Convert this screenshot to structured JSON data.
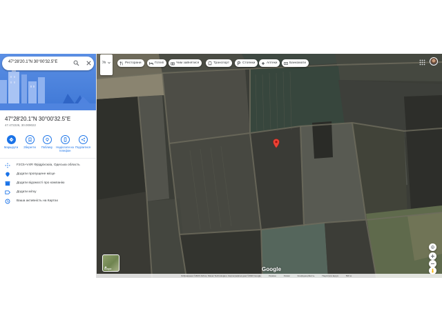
{
  "search": {
    "value": "47°28'20.1\"N 30°00'32.5\"E",
    "search_icon": "search-icon",
    "close_icon": "close-icon"
  },
  "place": {
    "title": "47°28'20.1\"N 30°00'32.5\"E",
    "subtitle": "47.472226, 30.009022"
  },
  "actions": [
    {
      "label": "Маршрути",
      "icon": "directions-icon"
    },
    {
      "label": "Зберегти",
      "icon": "bookmark-icon"
    },
    {
      "label": "Поблизу",
      "icon": "nearby-icon"
    },
    {
      "label": "Надіслати на телефон",
      "icon": "phone-icon"
    },
    {
      "label": "Поділитися",
      "icon": "share-icon"
    }
  ],
  "info": [
    {
      "text": "F2C5+V4R Фрідріхсюіа, Одеська область",
      "icon": "plus-code-icon"
    },
    {
      "text": "Додати пропущене місце",
      "icon": "add-place-icon"
    },
    {
      "text": "Додати відомості про компанію",
      "icon": "business-icon"
    },
    {
      "text": "Додати мітку",
      "icon": "label-icon"
    },
    {
      "text": "Ваша активність на Картах",
      "icon": "history-icon"
    }
  ],
  "map": {
    "menu_label": "Ук",
    "chips": [
      {
        "label": "Ресторани",
        "icon": "restaurant-icon"
      },
      {
        "label": "Готелі",
        "icon": "hotel-icon"
      },
      {
        "label": "Чим зайнятися",
        "icon": "camera-icon"
      },
      {
        "label": "Транспорт",
        "icon": "transit-icon"
      },
      {
        "label": "Стоянки",
        "icon": "parking-icon"
      },
      {
        "label": "Аптеки",
        "icon": "pharmacy-icon"
      },
      {
        "label": "Банкомати",
        "icon": "atm-icon"
      }
    ],
    "layers_label": "Шари",
    "google_logo": "Google",
    "footer": [
      "Зображення ©2023 Airbus, Maxar Technologies, Картографічні дані ©2023 Google",
      "Україна",
      "Умови",
      "Конфіденційність",
      "Надіслати відгук",
      "500 м"
    ],
    "colors": {
      "pin": "#ea4335",
      "accent": "#1a73e8"
    }
  }
}
